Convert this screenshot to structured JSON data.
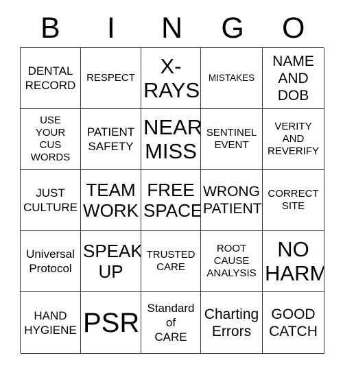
{
  "card": {
    "title": "BINGO",
    "header_letters": [
      "B",
      "I",
      "N",
      "G",
      "O"
    ],
    "columns": 5,
    "rows": 5,
    "border_color": "#3a3a3a",
    "background_color": "#ffffff",
    "text_color": "#000000",
    "free_space_position": "row 3, column 3",
    "cells": [
      [
        {
          "text": "DENTAL\nRECORD",
          "size": "md"
        },
        {
          "text": "RESPECT",
          "size": "sm"
        },
        {
          "text": "X-\nRAYS",
          "size": "2xl"
        },
        {
          "text": "MISTAKES",
          "size": "xs"
        },
        {
          "text": "NAME\nAND\nDOB",
          "size": "lg"
        }
      ],
      [
        {
          "text": "USE\nYOUR\nCUS\nWORDS",
          "size": "sm"
        },
        {
          "text": "PATIENT\nSAFETY",
          "size": "md"
        },
        {
          "text": "NEAR\nMISS",
          "size": "2xl"
        },
        {
          "text": "SENTINEL\nEVENT",
          "size": "sm"
        },
        {
          "text": "VERITY\nAND\nREVERIFY",
          "size": "sm"
        }
      ],
      [
        {
          "text": "JUST\nCULTURE",
          "size": "md"
        },
        {
          "text": "TEAM\nWORK",
          "size": "xl"
        },
        {
          "text": "FREE\nSPACE!",
          "size": "xl"
        },
        {
          "text": "WRONG\nPATIENT",
          "size": "lg"
        },
        {
          "text": "CORRECT\nSITE",
          "size": "sm"
        }
      ],
      [
        {
          "text": "Universal\nProtocol",
          "size": "md"
        },
        {
          "text": "SPEAK\nUP",
          "size": "xl"
        },
        {
          "text": "TRUSTED\nCARE",
          "size": "sm"
        },
        {
          "text": "ROOT\nCAUSE\nANALYSIS",
          "size": "sm"
        },
        {
          "text": "NO\nHARM",
          "size": "2xl"
        }
      ],
      [
        {
          "text": "HAND\nHYGIENE",
          "size": "md"
        },
        {
          "text": "PSR",
          "size": "3xl"
        },
        {
          "text": "Standard\nof\nCARE",
          "size": "md"
        },
        {
          "text": "Charting\nErrors",
          "size": "lg"
        },
        {
          "text": "GOOD\nCATCH",
          "size": "lg"
        }
      ]
    ]
  }
}
